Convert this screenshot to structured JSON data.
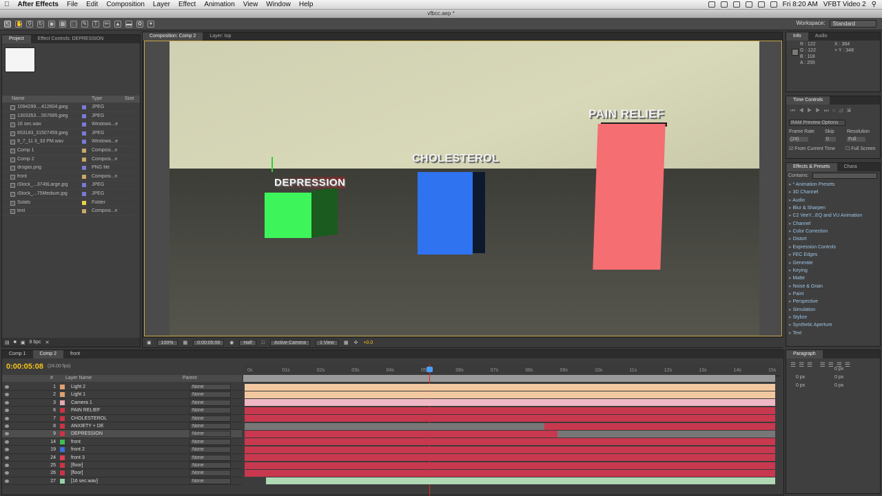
{
  "menubar": {
    "app_name": "After Effects",
    "items": [
      "File",
      "Edit",
      "Composition",
      "Layer",
      "Effect",
      "Animation",
      "View",
      "Window",
      "Help"
    ],
    "clock": "Fri 8:20 AM",
    "user": "VFBT Video 2"
  },
  "window_title": "vfbcc.aep *",
  "workspace": {
    "label": "Workspace:",
    "value": "Standard"
  },
  "project_panel": {
    "tabs": [
      "Project",
      "Effect Controls: DEPRESSION"
    ],
    "columns": {
      "name": "Name",
      "type": "Type",
      "size": "Size"
    },
    "items": [
      {
        "name": "1094299....412604.jpeg",
        "type": "JPEG",
        "color": "#7a7ad6"
      },
      {
        "name": "1303353....557685.jpeg",
        "type": "JPEG",
        "color": "#7a7ad6"
      },
      {
        "name": "16 sec.wav",
        "type": "Windows...e",
        "color": "#7a7ad6"
      },
      {
        "name": "653183_31507459.jpeg",
        "type": "JPEG",
        "color": "#7a7ad6"
      },
      {
        "name": "9_7_11 3_33 PM.wav",
        "type": "Windows...e",
        "color": "#7a7ad6"
      },
      {
        "name": "Comp 1",
        "type": "Composi...n",
        "color": "#c9a86a"
      },
      {
        "name": "Comp 2",
        "type": "Composi...n",
        "color": "#c9a86a"
      },
      {
        "name": "drogas.png",
        "type": "PNG file",
        "color": "#7a7ad6"
      },
      {
        "name": "front",
        "type": "Composi...n",
        "color": "#c9a86a"
      },
      {
        "name": "iStock_...3749Large.jpg",
        "type": "JPEG",
        "color": "#7a7ad6"
      },
      {
        "name": "iStock_...75Medium.jpg",
        "type": "JPEG",
        "color": "#7a7ad6"
      },
      {
        "name": "Solids",
        "type": "Folder",
        "color": "#e8d24a"
      },
      {
        "name": "text",
        "type": "Composi...n",
        "color": "#c9a86a"
      }
    ],
    "footer_bpc": "8 bpc"
  },
  "composition": {
    "tab": "Composition: Comp 2",
    "layer_tab": "Layer: top",
    "labels": {
      "depression": "DEPRESSION",
      "cholesterol": "CHOLESTEROL",
      "pain": "PAIN RELIEF"
    },
    "footer": {
      "zoom": "100%",
      "time": "0:00:05:08",
      "resolution": "Half",
      "camera": "Active Camera",
      "view": "1 View",
      "exposure": "+0.0"
    }
  },
  "info_panel": {
    "tabs": [
      "Info",
      "Audio"
    ],
    "r": "R : 122",
    "g": "G : 122",
    "b": "B : 118",
    "a": "A : 255",
    "x": "X : 364",
    "y": "+ Y : 348"
  },
  "time_controls": {
    "tab": "Time Controls",
    "preview_options": "RAM Preview Options",
    "frame_rate_label": "Frame Rate",
    "skip_label": "Skip",
    "resolution_label": "Resolution",
    "frame_rate": "(24)",
    "skip": "0",
    "resolution": "Full",
    "from_current": "From Current Time",
    "full_screen": "Full Screen"
  },
  "effects_panel": {
    "tabs": [
      "Effects & Presets",
      "Chara"
    ],
    "contains_label": "Contains:",
    "items": [
      "* Animation Presets",
      "3D Channel",
      "Audio",
      "Blur & Sharpen",
      "C2 VeeY...EQ and VU Animation",
      "Channel",
      "Color Correction",
      "Distort",
      "Expression Controls",
      "FEC Edges",
      "Generate",
      "Keying",
      "Matte",
      "Noise & Grain",
      "Paint",
      "Perspective",
      "Simulation",
      "Stylize",
      "Synthetic Aperture",
      "Text"
    ]
  },
  "paragraph_panel": {
    "tab": "Paragraph",
    "fields": [
      "0 px",
      "0 px",
      "0 px",
      "0 px",
      "0 px"
    ]
  },
  "timeline": {
    "tabs": [
      "Comp 1",
      "Comp 2",
      "front"
    ],
    "timecode": "0:00:05:08",
    "fps": "(24.00 fps)",
    "col_num": "#",
    "col_name": "Layer Name",
    "col_parent": "Parent",
    "ticks": [
      "0s",
      "01s",
      "02s",
      "03s",
      "04s",
      "05s",
      "06s",
      "07s",
      "08s",
      "09s",
      "10s",
      "11s",
      "12s",
      "13s",
      "14s",
      "15s"
    ],
    "layers": [
      {
        "num": "1",
        "name": "Light 2",
        "color": "#e0a070",
        "bar": "#f2c8a0",
        "start": 0,
        "end": 1
      },
      {
        "num": "2",
        "name": "Light 1",
        "color": "#e0a070",
        "bar": "#f2c8a0",
        "start": 0,
        "end": 1
      },
      {
        "num": "3",
        "name": "Camera 1",
        "color": "#e8a8b0",
        "bar": "#f0b8c4",
        "start": 0,
        "end": 1
      },
      {
        "num": "6",
        "name": "PAIN RELIEF",
        "color": "#cc3344",
        "bar": "#c8384e",
        "start": 0,
        "end": 1
      },
      {
        "num": "7",
        "name": "CHOLESTEROL",
        "color": "#cc3344",
        "bar": "#c8384e",
        "start": 0,
        "end": 1
      },
      {
        "num": "8",
        "name": "ANXIETY + DE",
        "color": "#cc3344",
        "bar": "#c8384e",
        "start": 0.565,
        "end": 1
      },
      {
        "num": "9",
        "name": "DEPRESSION",
        "color": "#cc3344",
        "bar": "#c8384e",
        "start": 0,
        "end": 0.59
      },
      {
        "num": "14",
        "name": "front",
        "color": "#3ec050",
        "bar": "#c8384e",
        "start": 0,
        "end": 1
      },
      {
        "num": "19",
        "name": "front 2",
        "color": "#3f6fe0",
        "bar": "#c8384e",
        "start": 0,
        "end": 1
      },
      {
        "num": "24",
        "name": "front 3",
        "color": "#e04050",
        "bar": "#c8384e",
        "start": 0,
        "end": 1
      },
      {
        "num": "25",
        "name": "[floor]",
        "color": "#cc3344",
        "bar": "#c8384e",
        "start": 0,
        "end": 1
      },
      {
        "num": "26",
        "name": "[floor]",
        "color": "#cc3344",
        "bar": "#c8384e",
        "start": 0,
        "end": 1
      },
      {
        "num": "27",
        "name": "[16 sec.wav]",
        "color": "#9ad0a8",
        "bar": "#b0d8b4",
        "start": 0.04,
        "end": 1
      }
    ],
    "parent_value": "None"
  }
}
